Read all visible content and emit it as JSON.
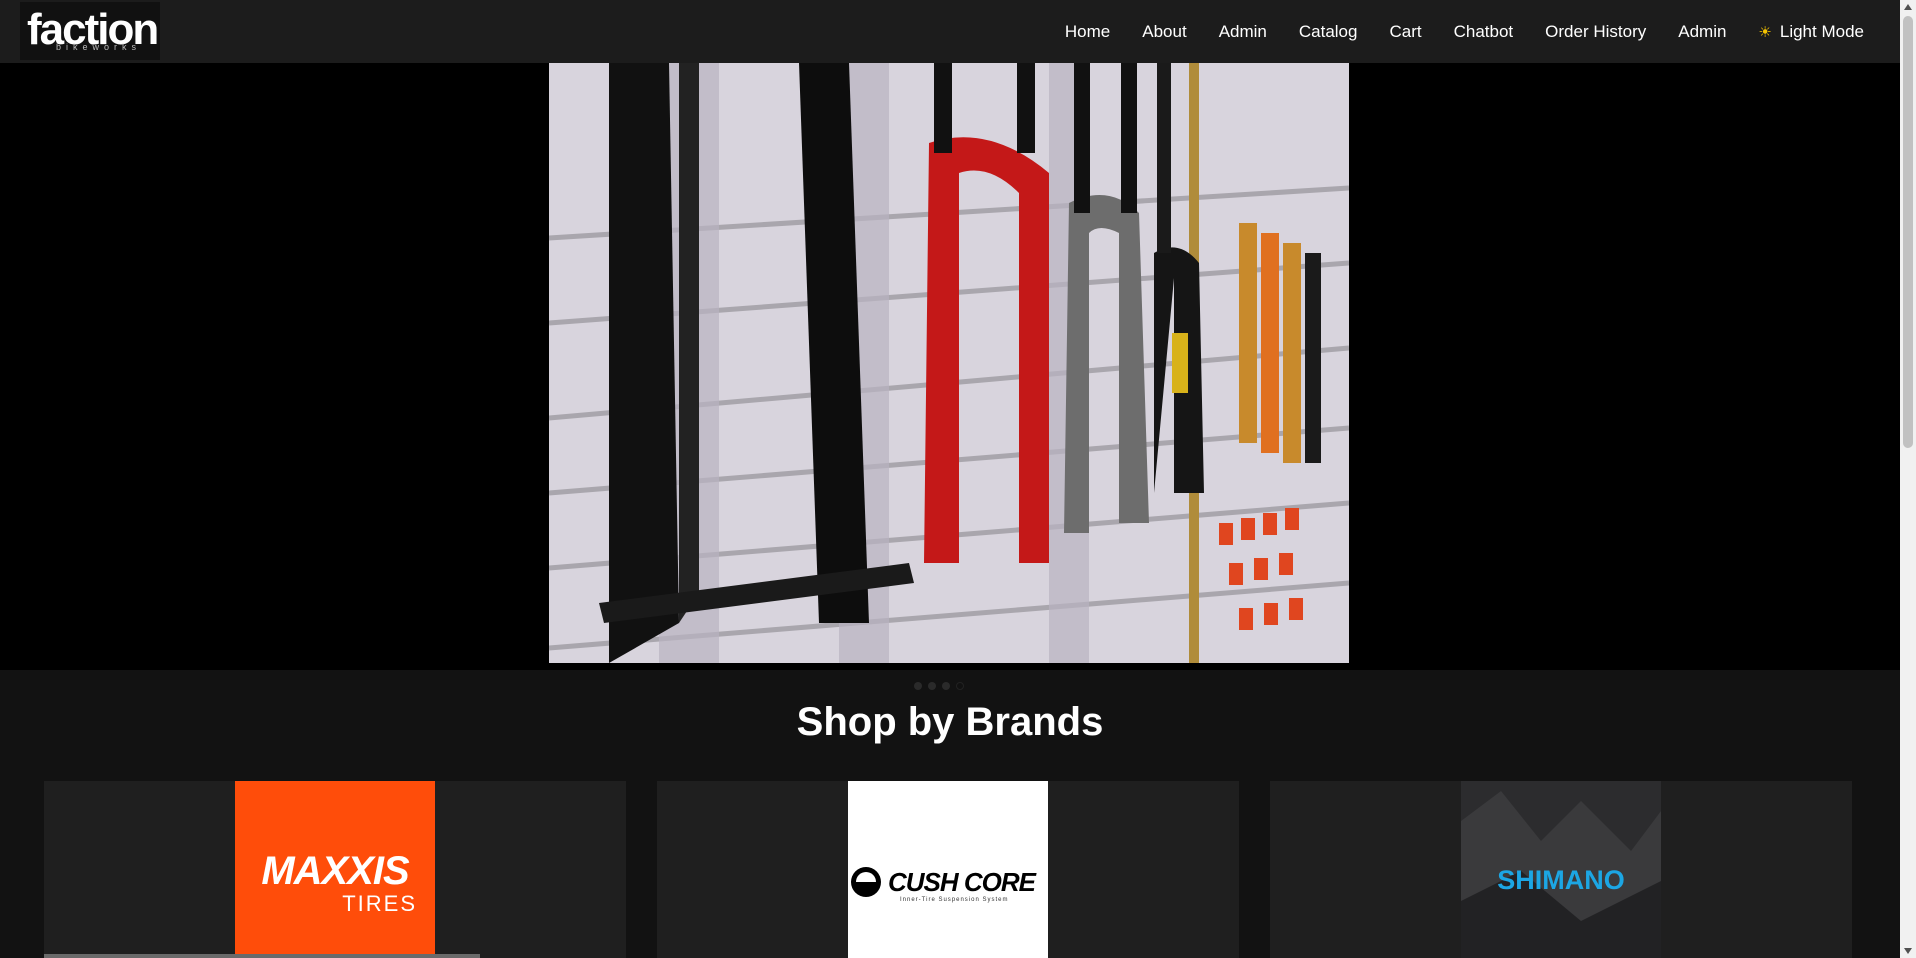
{
  "brand": {
    "name": "faction",
    "tagline": "bikeworks"
  },
  "nav": {
    "links": [
      "Home",
      "About",
      "Admin",
      "Catalog",
      "Cart",
      "Chatbot",
      "Order History",
      "Admin"
    ],
    "theme_toggle": "Light Mode",
    "theme_icon": "sun-icon"
  },
  "hero": {
    "image_subject": "suspension forks on wall display",
    "slides": 4,
    "active_slide": 4
  },
  "brands_section": {
    "title": "Shop by Brands",
    "brands": [
      {
        "name": "MAXXIS",
        "sub": "TIRES",
        "color": "#ff4d0a"
      },
      {
        "name": "CUSH CORE",
        "sub": "Inner-Tire Suspension System",
        "color": "#ffffff"
      },
      {
        "name": "SHIMANO",
        "color": "#1ca6e4"
      }
    ]
  },
  "colors": {
    "background": "#121212",
    "navbar": "#1c1c1c",
    "card": "#1f1f1f"
  }
}
